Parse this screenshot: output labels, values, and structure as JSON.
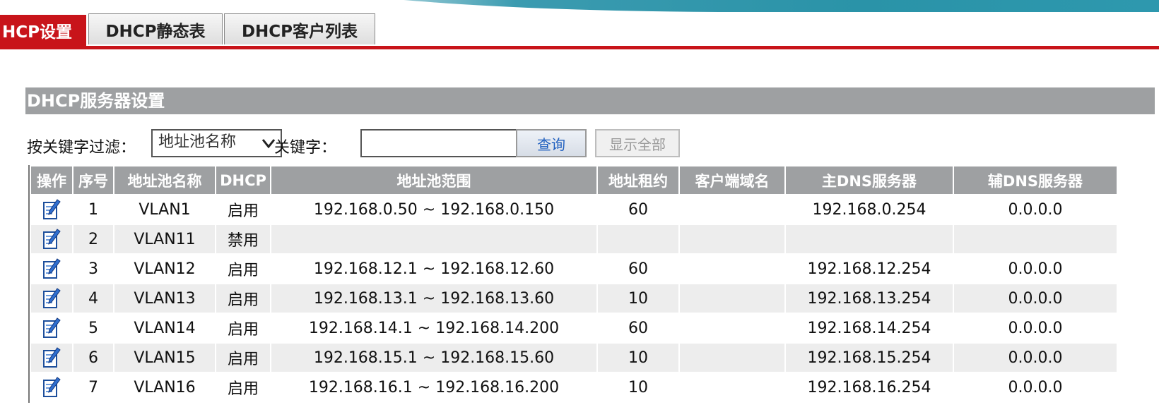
{
  "tabs": [
    {
      "label": "HCP设置",
      "active": true
    },
    {
      "label": "DHCP静态表",
      "active": false
    },
    {
      "label": "DHCP客户列表",
      "active": false
    }
  ],
  "section_title": "DHCP服务器设置",
  "filter": {
    "label": "按关键字过滤：",
    "select_value": "地址池名称",
    "keyword_label": "关键字：",
    "keyword_value": "",
    "query_button": "查询",
    "show_all_button": "显示全部"
  },
  "table": {
    "headers": [
      "操作",
      "序号",
      "地址池名称",
      "DHCP",
      "地址池范围",
      "地址租约",
      "客户端域名",
      "主DNS服务器",
      "辅DNS服务器"
    ],
    "rows": [
      {
        "index": "1",
        "name": "VLAN1",
        "dhcp": "启用",
        "range": "192.168.0.50 ~ 192.168.0.150",
        "lease": "60",
        "domain": "",
        "dns1": "192.168.0.254",
        "dns2": "0.0.0.0"
      },
      {
        "index": "2",
        "name": "VLAN11",
        "dhcp": "禁用",
        "range": "",
        "lease": "",
        "domain": "",
        "dns1": "",
        "dns2": ""
      },
      {
        "index": "3",
        "name": "VLAN12",
        "dhcp": "启用",
        "range": "192.168.12.1 ~ 192.168.12.60",
        "lease": "60",
        "domain": "",
        "dns1": "192.168.12.254",
        "dns2": "0.0.0.0"
      },
      {
        "index": "4",
        "name": "VLAN13",
        "dhcp": "启用",
        "range": "192.168.13.1 ~ 192.168.13.60",
        "lease": "10",
        "domain": "",
        "dns1": "192.168.13.254",
        "dns2": "0.0.0.0"
      },
      {
        "index": "5",
        "name": "VLAN14",
        "dhcp": "启用",
        "range": "192.168.14.1 ~ 192.168.14.200",
        "lease": "60",
        "domain": "",
        "dns1": "192.168.14.254",
        "dns2": "0.0.0.0"
      },
      {
        "index": "6",
        "name": "VLAN15",
        "dhcp": "启用",
        "range": "192.168.15.1 ~ 192.168.15.60",
        "lease": "10",
        "domain": "",
        "dns1": "192.168.15.254",
        "dns2": "0.0.0.0"
      },
      {
        "index": "7",
        "name": "VLAN16",
        "dhcp": "启用",
        "range": "192.168.16.1 ~ 192.168.16.200",
        "lease": "10",
        "domain": "",
        "dns1": "192.168.16.254",
        "dns2": "0.0.0.0"
      }
    ]
  },
  "icons": {
    "edit": "edit-note-icon",
    "dropdown": "chevron-down-icon"
  },
  "colors": {
    "accent_red": "#c8141a",
    "header_gray": "#9ea0a2",
    "row_alt": "#ededed",
    "query_text": "#1f5fbf",
    "teal_band": "#2a93a8"
  }
}
